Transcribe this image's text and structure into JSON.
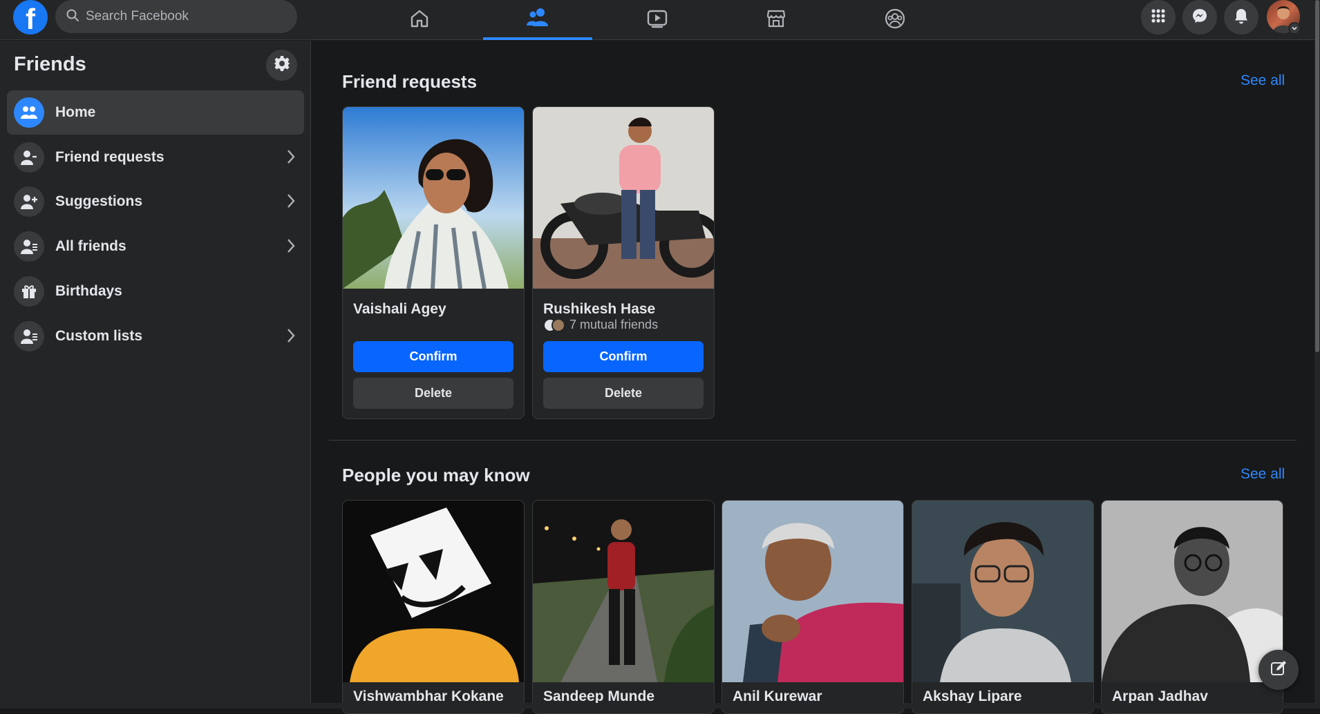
{
  "app": {
    "logo_letter": "f"
  },
  "search": {
    "placeholder": "Search Facebook"
  },
  "nav": {
    "tabs": [
      {
        "name": "home",
        "icon": "home-icon"
      },
      {
        "name": "friends",
        "icon": "friends-icon",
        "active": true
      },
      {
        "name": "watch",
        "icon": "watch-icon"
      },
      {
        "name": "marketplace",
        "icon": "marketplace-icon"
      },
      {
        "name": "groups",
        "icon": "groups-icon"
      }
    ],
    "right": [
      "menu-grid-icon",
      "messenger-icon",
      "bell-icon",
      "avatar"
    ]
  },
  "sidebar": {
    "title": "Friends",
    "items": [
      {
        "label": "Home",
        "icon": "friends-icon",
        "active": true,
        "chevron": false
      },
      {
        "label": "Friend requests",
        "icon": "person-add-icon",
        "chevron": true
      },
      {
        "label": "Suggestions",
        "icon": "person-plus-icon",
        "chevron": true
      },
      {
        "label": "All friends",
        "icon": "person-list-icon",
        "chevron": true
      },
      {
        "label": "Birthdays",
        "icon": "gift-icon",
        "chevron": false
      },
      {
        "label": "Custom lists",
        "icon": "person-list-icon",
        "chevron": true
      }
    ]
  },
  "friend_requests": {
    "title": "Friend requests",
    "see_all": "See all",
    "cards": [
      {
        "name": "Vaishali Agey",
        "mutual": "",
        "confirm": "Confirm",
        "delete": "Delete"
      },
      {
        "name": "Rushikesh Hase",
        "mutual": "7 mutual friends",
        "confirm": "Confirm",
        "delete": "Delete"
      }
    ]
  },
  "people_you_may_know": {
    "title": "People you may know",
    "see_all": "See all",
    "cards": [
      {
        "name": "Vishwambhar Kokane"
      },
      {
        "name": "Sandeep Munde"
      },
      {
        "name": "Anil Kurewar"
      },
      {
        "name": "Akshay Lipare"
      },
      {
        "name": "Arpan Jadhav"
      }
    ]
  },
  "colors": {
    "accent": "#2d88ff",
    "confirm": "#0866ff",
    "bg": "#18191a",
    "surface": "#242526"
  }
}
